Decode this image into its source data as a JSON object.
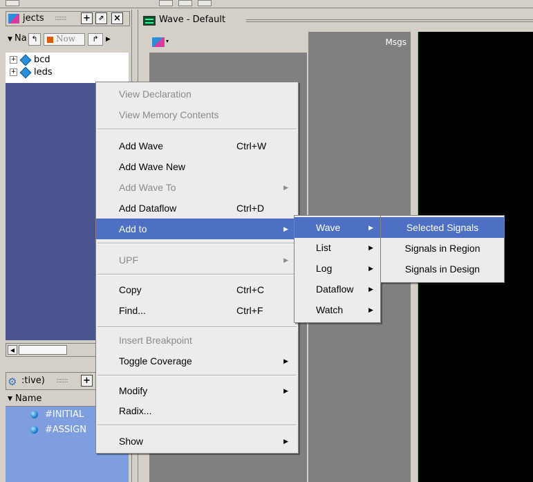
{
  "objects_pane": {
    "title": "jects",
    "toolbar": {
      "name_col": "Na",
      "now_label": "Now"
    },
    "items": [
      {
        "label": "bcd"
      },
      {
        "label": "leds"
      }
    ]
  },
  "processes_pane": {
    "title": ":tive)",
    "name_header": "Name",
    "items": [
      {
        "label": "#INITIAL"
      },
      {
        "label": "#ASSIGN"
      }
    ]
  },
  "wave_window": {
    "title": "Wave - Default",
    "msgs_header": "Msgs"
  },
  "context_menu": {
    "items": [
      {
        "label": "View Declaration"
      },
      {
        "label": "View Memory Contents"
      },
      {
        "label": "Add Wave",
        "shortcut": "Ctrl+W"
      },
      {
        "label": "Add Wave New"
      },
      {
        "label": "Add Wave To"
      },
      {
        "label": "Add Dataflow",
        "shortcut": "Ctrl+D"
      },
      {
        "label": "Add to"
      },
      {
        "label": "UPF"
      },
      {
        "label": "Copy",
        "shortcut": "Ctrl+C"
      },
      {
        "label": "Find...",
        "shortcut": "Ctrl+F"
      },
      {
        "label": "Insert Breakpoint"
      },
      {
        "label": "Toggle Coverage"
      },
      {
        "label": "Modify"
      },
      {
        "label": "Radix..."
      },
      {
        "label": "Show"
      }
    ]
  },
  "addto_submenu": {
    "items": [
      {
        "label": "Wave"
      },
      {
        "label": "List"
      },
      {
        "label": "Log"
      },
      {
        "label": "Dataflow"
      },
      {
        "label": "Watch"
      }
    ]
  },
  "wave_submenu": {
    "items": [
      {
        "label": "Selected Signals"
      },
      {
        "label": "Signals in Region"
      },
      {
        "label": "Signals in Design"
      }
    ]
  },
  "colors": {
    "highlight": "#4d6fc4",
    "wave_bg": "#000000",
    "pane_blue": "#4a5590"
  }
}
